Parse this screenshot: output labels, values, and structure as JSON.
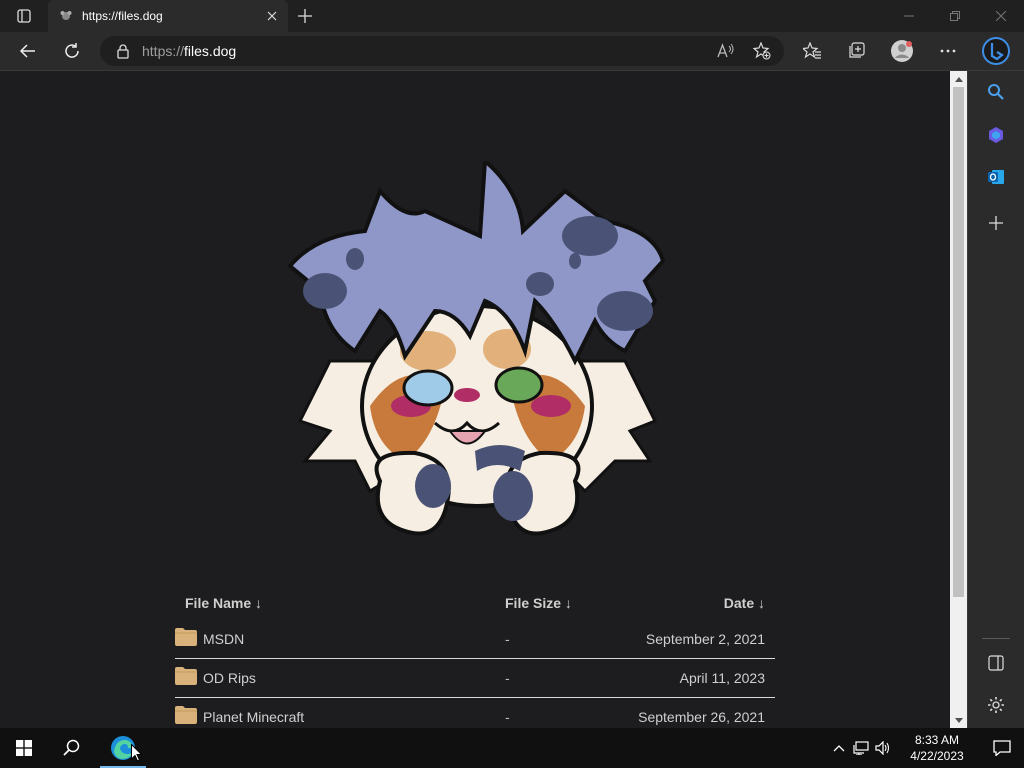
{
  "browser": {
    "tab_title": "https://files.dog",
    "url_protocol": "https://",
    "url_host": "files.dog"
  },
  "file_list": {
    "headers": {
      "name": "File Name  ↓",
      "size": "File Size  ↓",
      "date": "Date  ↓"
    },
    "rows": [
      {
        "name": "MSDN",
        "size": "-",
        "date": "September 2, 2021"
      },
      {
        "name": "OD Rips",
        "size": "-",
        "date": "April 11, 2023"
      },
      {
        "name": "Planet Minecraft",
        "size": "-",
        "date": "September 26, 2021"
      }
    ]
  },
  "taskbar": {
    "time": "8:33 AM",
    "date": "4/22/2023"
  },
  "colors": {
    "page_background": "#1d1d1f",
    "folder": "#d8b27a",
    "accent": "#76b9ed"
  },
  "icons": {
    "tab_actions": "tab-actions-icon",
    "favicon": "dog-favicon-icon",
    "back": "back-arrow-icon",
    "refresh": "refresh-icon",
    "lock": "lock-icon",
    "read_aloud": "read-aloud-icon",
    "favorite": "star-add-icon",
    "favorites": "favorites-icon",
    "collections": "collections-icon",
    "profile": "profile-icon",
    "more": "more-icon",
    "bing": "bing-icon"
  }
}
